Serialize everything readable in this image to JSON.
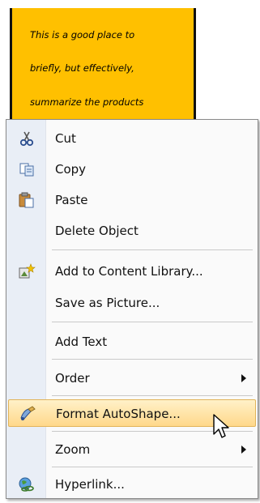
{
  "autoshape": {
    "lines": [
      "This is a good place to",
      "briefly, but effectively,",
      "summarize the products"
    ]
  },
  "context_menu": {
    "items": [
      {
        "label": "Cut",
        "icon": "scissors-icon"
      },
      {
        "label": "Copy",
        "icon": "copy-icon"
      },
      {
        "label": "Paste",
        "icon": "paste-icon"
      },
      {
        "label": "Delete Object",
        "icon": ""
      },
      {
        "label": "Add to Content Library...",
        "icon": "content-library-icon"
      },
      {
        "label": "Save as Picture...",
        "icon": ""
      },
      {
        "label": "Add Text",
        "icon": ""
      },
      {
        "label": "Order",
        "icon": "",
        "submenu": true
      },
      {
        "label": "Format AutoShape...",
        "icon": "format-autoshape-icon",
        "highlighted": true
      },
      {
        "label": "Zoom",
        "icon": "",
        "submenu": true
      },
      {
        "label": "Hyperlink...",
        "icon": "hyperlink-globe-icon"
      }
    ]
  },
  "colors": {
    "autoshape_fill": "#ffc000",
    "highlight": "#ffd88a",
    "gutter": "#e9eef6"
  }
}
